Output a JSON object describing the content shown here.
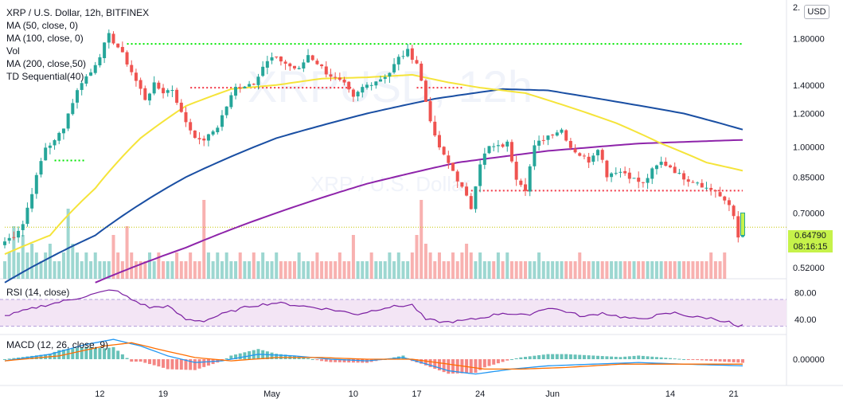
{
  "header": {
    "title": "XRP / U.S. Dollar, 12h, BITFINEX",
    "indicators": [
      "MA (50, close, 0)",
      "MA (100, close, 0)",
      "Vol",
      "MA (200, close,50)",
      "TD Sequential(40)"
    ],
    "currency_button": "USD"
  },
  "watermark": {
    "symbol": "XRPUSD, 12h",
    "name": "XRP / U.S. Dollar"
  },
  "current_price": {
    "price": "0.64790",
    "countdown": "08:16:15"
  },
  "colors": {
    "up": "#26a69a",
    "down": "#ef5350",
    "ma50": "#f5e43a",
    "ma100": "#1a4fa3",
    "ma200": "#8e24aa",
    "rsi": "#7b1fa2",
    "rsi_band": "#f3e5f5",
    "macd": "#2196f3",
    "signal": "#ff6d00",
    "hist_up": "#26a69a",
    "hist_down": "#ef5350",
    "resistance": "#00e600",
    "support": "#f23645",
    "price_tag": "#c6f24a"
  },
  "chart_data": [
    {
      "type": "candlestick",
      "title": "XRP / U.S. Dollar, 12h, BITFINEX",
      "y_scale": "log",
      "ylim": [
        0.49,
        2.22
      ],
      "y_ticks": [
        "2.",
        "1.80000",
        "1.40000",
        "1.20000",
        "1.00000",
        "0.85000",
        "0.70000",
        "0.52000"
      ],
      "x_ticks": [
        {
          "label": "12",
          "index": 21
        },
        {
          "label": "19",
          "index": 35
        },
        {
          "label": "May",
          "index": 59
        },
        {
          "label": "10",
          "index": 77
        },
        {
          "label": "17",
          "index": 91
        },
        {
          "label": "24",
          "index": 105
        },
        {
          "label": "Jun",
          "index": 121
        },
        {
          "label": "14",
          "index": 147
        },
        {
          "label": "21",
          "index": 161
        }
      ],
      "close_anchors": [
        [
          0,
          0.6
        ],
        [
          2,
          0.62
        ],
        [
          4,
          0.66
        ],
        [
          5,
          0.72
        ],
        [
          7,
          0.85
        ],
        [
          9,
          1.0
        ],
        [
          11,
          1.03
        ],
        [
          13,
          1.12
        ],
        [
          15,
          1.28
        ],
        [
          17,
          1.43
        ],
        [
          19,
          1.5
        ],
        [
          21,
          1.65
        ],
        [
          23,
          1.83
        ],
        [
          25,
          1.72
        ],
        [
          27,
          1.58
        ],
        [
          29,
          1.43
        ],
        [
          31,
          1.3
        ],
        [
          33,
          1.4
        ],
        [
          35,
          1.35
        ],
        [
          37,
          1.37
        ],
        [
          39,
          1.2
        ],
        [
          41,
          1.1
        ],
        [
          43,
          1.03
        ],
        [
          45,
          1.06
        ],
        [
          47,
          1.12
        ],
        [
          49,
          1.25
        ],
        [
          51,
          1.38
        ],
        [
          53,
          1.4
        ],
        [
          55,
          1.42
        ],
        [
          57,
          1.55
        ],
        [
          59,
          1.62
        ],
        [
          61,
          1.6
        ],
        [
          63,
          1.55
        ],
        [
          65,
          1.52
        ],
        [
          67,
          1.65
        ],
        [
          69,
          1.58
        ],
        [
          71,
          1.5
        ],
        [
          73,
          1.45
        ],
        [
          75,
          1.4
        ],
        [
          77,
          1.3
        ],
        [
          79,
          1.38
        ],
        [
          81,
          1.42
        ],
        [
          83,
          1.45
        ],
        [
          85,
          1.5
        ],
        [
          87,
          1.62
        ],
        [
          89,
          1.68
        ],
        [
          91,
          1.58
        ],
        [
          93,
          1.28
        ],
        [
          95,
          1.05
        ],
        [
          97,
          0.95
        ],
        [
          99,
          0.88
        ],
        [
          101,
          0.8
        ],
        [
          103,
          0.72
        ],
        [
          105,
          0.92
        ],
        [
          107,
          1.0
        ],
        [
          109,
          1.0
        ],
        [
          111,
          1.02
        ],
        [
          113,
          0.85
        ],
        [
          115,
          0.8
        ],
        [
          117,
          1.0
        ],
        [
          119,
          1.05
        ],
        [
          121,
          1.08
        ],
        [
          123,
          1.1
        ],
        [
          125,
          1.0
        ],
        [
          127,
          0.96
        ],
        [
          129,
          0.93
        ],
        [
          131,
          1.0
        ],
        [
          133,
          0.86
        ],
        [
          135,
          0.88
        ],
        [
          137,
          0.87
        ],
        [
          139,
          0.84
        ],
        [
          141,
          0.82
        ],
        [
          143,
          0.88
        ],
        [
          145,
          0.92
        ],
        [
          147,
          0.9
        ],
        [
          149,
          0.86
        ],
        [
          151,
          0.84
        ],
        [
          153,
          0.83
        ],
        [
          155,
          0.8
        ],
        [
          157,
          0.79
        ],
        [
          159,
          0.74
        ],
        [
          160,
          0.73
        ],
        [
          161,
          0.69
        ],
        [
          162,
          0.62
        ],
        [
          163,
          0.65
        ]
      ],
      "ma50_anchors": [
        [
          0,
          0.56
        ],
        [
          10,
          0.62
        ],
        [
          20,
          0.8
        ],
        [
          30,
          1.05
        ],
        [
          40,
          1.25
        ],
        [
          50,
          1.37
        ],
        [
          60,
          1.4
        ],
        [
          70,
          1.45
        ],
        [
          80,
          1.46
        ],
        [
          90,
          1.48
        ],
        [
          98,
          1.42
        ],
        [
          105,
          1.38
        ],
        [
          115,
          1.34
        ],
        [
          125,
          1.24
        ],
        [
          135,
          1.14
        ],
        [
          145,
          1.02
        ],
        [
          155,
          0.92
        ],
        [
          163,
          0.88
        ]
      ],
      "ma100_anchors": [
        [
          0,
          0.48
        ],
        [
          20,
          0.62
        ],
        [
          40,
          0.85
        ],
        [
          60,
          1.05
        ],
        [
          80,
          1.2
        ],
        [
          95,
          1.3
        ],
        [
          110,
          1.37
        ],
        [
          120,
          1.36
        ],
        [
          135,
          1.28
        ],
        [
          150,
          1.2
        ],
        [
          163,
          1.1
        ]
      ],
      "ma200_anchors": [
        [
          20,
          0.48
        ],
        [
          40,
          0.58
        ],
        [
          60,
          0.7
        ],
        [
          80,
          0.82
        ],
        [
          100,
          0.92
        ],
        [
          120,
          0.98
        ],
        [
          140,
          1.02
        ],
        [
          163,
          1.04
        ]
      ],
      "resistance_lines": [
        {
          "price": 1.75,
          "from": 27,
          "to": 163,
          "color": "#00e600"
        },
        {
          "price": 0.93,
          "from": 11,
          "to": 18,
          "color": "#00e600"
        }
      ],
      "support_lines": [
        {
          "price": 1.38,
          "from": 41,
          "to": 77,
          "color": "#f23645"
        },
        {
          "price": 1.38,
          "from": 91,
          "to": 101,
          "color": "#f23645"
        },
        {
          "price": 0.79,
          "from": 103,
          "to": 163,
          "color": "#f23645"
        }
      ],
      "current_price_line": 0.6479
    },
    {
      "type": "bar",
      "title": "Vol",
      "values_relative": [
        0.2,
        0.3,
        0.6,
        0.3,
        0.5,
        0.3,
        0.4,
        0.3,
        0.2,
        0.3,
        0.4,
        0.2,
        0.2,
        0.3,
        0.8,
        0.4,
        0.3,
        0.2,
        0.3,
        0.2,
        0.3,
        0.2,
        0.2,
        0.2,
        0.5,
        0.3,
        0.2,
        0.6,
        0.3,
        0.2,
        0.2,
        0.2,
        0.3,
        0.2,
        0.3,
        0.2,
        0.2,
        0.2,
        0.3,
        0.2,
        0.2,
        0.3,
        0.2,
        0.2,
        0.9,
        0.3,
        0.2,
        0.3,
        0.2,
        0.3,
        0.2,
        0.2,
        0.3,
        0.2,
        0.2,
        0.3,
        0.2,
        0.3,
        0.2,
        0.2,
        0.3,
        0.2,
        0.2,
        0.2,
        0.2,
        0.3,
        0.2,
        0.2,
        0.2,
        0.3,
        0.2,
        0.2,
        0.2,
        0.2,
        0.3,
        0.2,
        0.2,
        0.5,
        0.2,
        0.2,
        0.2,
        0.3,
        0.2,
        0.2,
        0.2,
        0.3,
        0.2,
        0.3,
        0.2,
        0.2,
        0.3,
        0.5,
        0.9,
        0.4,
        0.3,
        0.2,
        0.3,
        0.2,
        0.2,
        0.3,
        0.2,
        0.3,
        0.4,
        0.3,
        0.2,
        0.3,
        0.2,
        0.2,
        0.2,
        0.3,
        0.2,
        0.3,
        0.2,
        0.2,
        0.2,
        0.2,
        0.2,
        0.2,
        0.3,
        0.2,
        0.2,
        0.2,
        0.2,
        0.2,
        0.2,
        0.2,
        0.2,
        0.3,
        0.2,
        0.2,
        0.2,
        0.2,
        0.2,
        0.2,
        0.2,
        0.2,
        0.2,
        0.2,
        0.2,
        0.2,
        0.2,
        0.2,
        0.2,
        0.2,
        0.2,
        0.2,
        0.2,
        0.2,
        0.2,
        0.2,
        0.2,
        0.2,
        0.2,
        0.2,
        0.2,
        0.2,
        0.3,
        0.2,
        0.2,
        0.3
      ]
    },
    {
      "type": "line",
      "title": "RSI (14, close)",
      "y_ticks": [
        "80.00",
        "40.00"
      ],
      "ylim": [
        20,
        95
      ],
      "band": [
        30,
        70
      ],
      "anchors": [
        [
          0,
          45
        ],
        [
          8,
          60
        ],
        [
          16,
          72
        ],
        [
          24,
          85
        ],
        [
          28,
          70
        ],
        [
          32,
          58
        ],
        [
          36,
          60
        ],
        [
          40,
          40
        ],
        [
          44,
          38
        ],
        [
          48,
          48
        ],
        [
          54,
          60
        ],
        [
          60,
          65
        ],
        [
          66,
          60
        ],
        [
          72,
          55
        ],
        [
          78,
          48
        ],
        [
          84,
          58
        ],
        [
          90,
          62
        ],
        [
          93,
          40
        ],
        [
          97,
          36
        ],
        [
          101,
          38
        ],
        [
          105,
          42
        ],
        [
          110,
          50
        ],
        [
          115,
          46
        ],
        [
          120,
          58
        ],
        [
          124,
          52
        ],
        [
          128,
          44
        ],
        [
          132,
          50
        ],
        [
          136,
          44
        ],
        [
          140,
          40
        ],
        [
          144,
          46
        ],
        [
          148,
          50
        ],
        [
          152,
          44
        ],
        [
          156,
          42
        ],
        [
          160,
          36
        ],
        [
          162,
          28
        ],
        [
          163,
          32
        ]
      ]
    },
    {
      "type": "line",
      "title": "MACD (12, 26, close, 9)",
      "y_ticks": [
        "0.00000"
      ],
      "ylim": [
        -0.14,
        0.14
      ],
      "macd_anchors": [
        [
          0,
          -0.01
        ],
        [
          10,
          0.03
        ],
        [
          18,
          0.09
        ],
        [
          24,
          0.12
        ],
        [
          30,
          0.08
        ],
        [
          36,
          0.02
        ],
        [
          42,
          -0.02
        ],
        [
          48,
          -0.01
        ],
        [
          56,
          0.03
        ],
        [
          64,
          0.02
        ],
        [
          72,
          0.0
        ],
        [
          80,
          -0.01
        ],
        [
          88,
          0.01
        ],
        [
          92,
          -0.02
        ],
        [
          98,
          -0.07
        ],
        [
          104,
          -0.09
        ],
        [
          112,
          -0.06
        ],
        [
          120,
          -0.04
        ],
        [
          130,
          -0.03
        ],
        [
          140,
          -0.02
        ],
        [
          150,
          -0.03
        ],
        [
          163,
          -0.04
        ]
      ],
      "signal_anchors": [
        [
          0,
          -0.01
        ],
        [
          12,
          0.02
        ],
        [
          22,
          0.08
        ],
        [
          28,
          0.1
        ],
        [
          34,
          0.06
        ],
        [
          42,
          0.01
        ],
        [
          50,
          -0.01
        ],
        [
          60,
          0.01
        ],
        [
          70,
          0.01
        ],
        [
          80,
          0.0
        ],
        [
          90,
          0.0
        ],
        [
          98,
          -0.03
        ],
        [
          106,
          -0.06
        ],
        [
          114,
          -0.06
        ],
        [
          124,
          -0.05
        ],
        [
          136,
          -0.03
        ],
        [
          150,
          -0.03
        ],
        [
          163,
          -0.03
        ]
      ]
    }
  ]
}
